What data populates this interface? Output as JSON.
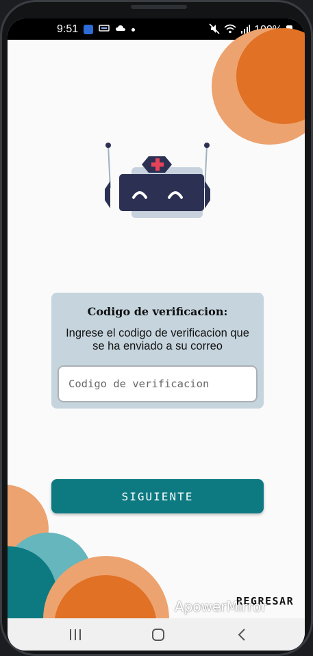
{
  "status_bar": {
    "time": "9:51",
    "battery_text": "100%"
  },
  "card": {
    "title": "Codigo de verificacion:",
    "description": "Ingrese el codigo de verificacion que se ha enviado a su correo",
    "input": {
      "placeholder": "Codigo de verificacion",
      "value": ""
    }
  },
  "actions": {
    "next_label": "SIGUIENTE",
    "back_label": "REGRESAR"
  },
  "overlay": {
    "watermark": "ApowerMirror"
  },
  "colors": {
    "primary_teal": "#0d7a82",
    "accent_orange": "#e07125",
    "light_orange": "#eda36f",
    "light_teal": "#66b6bd",
    "card_background": "#c5d4dd",
    "robot_navy": "#2c3154",
    "robot_red": "#e8425a"
  },
  "icons": {
    "status": [
      "app-notification-icon",
      "cast-icon",
      "cloud-icon",
      "dot-icon",
      "mute-icon",
      "wifi-icon",
      "signal-icon",
      "battery-icon"
    ],
    "navigation": [
      "recent-apps-icon",
      "home-icon",
      "back-icon"
    ],
    "logo": "nurse-robot-logo-icon"
  }
}
